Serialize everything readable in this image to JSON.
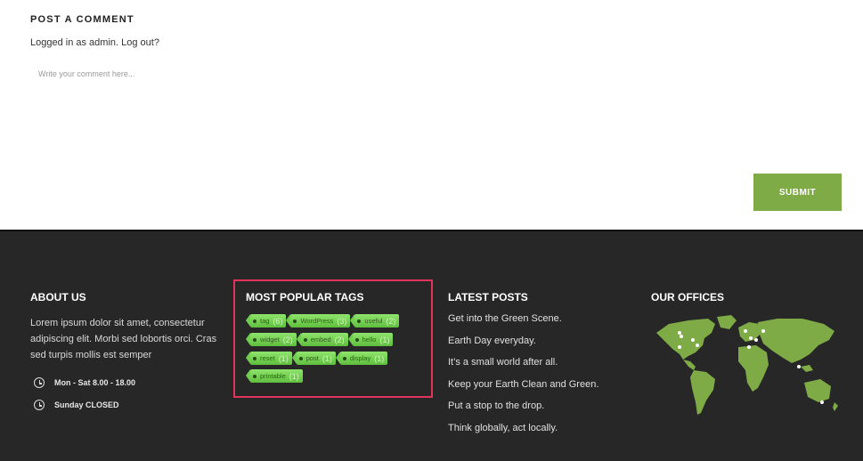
{
  "comment": {
    "title": "POST A COMMENT",
    "logged_in_prefix": "Logged in as admin. ",
    "logout_link": "Log out?",
    "placeholder": "Write your comment here...",
    "submit_label": "SUBMIT"
  },
  "footer": {
    "about": {
      "title": "ABOUT US",
      "text": "Lorem ipsum dolor sit amet, consectetur adipiscing elit. Morbi sed lobortis orci. Cras sed turpis mollis est semper",
      "hours_weekday": "Mon - Sat 8.00 - 18.00",
      "hours_sunday": "Sunday CLOSED"
    },
    "tags": {
      "title": "MOST POPULAR TAGS",
      "rows": [
        [
          {
            "name": "tag",
            "count": "(6)"
          },
          {
            "name": "WordPress",
            "count": "(3)"
          },
          {
            "name": "useful",
            "count": "(2)"
          }
        ],
        [
          {
            "name": "widget",
            "count": "(2)"
          },
          {
            "name": "embed",
            "count": "(2)"
          },
          {
            "name": "hello",
            "count": "(1)"
          }
        ],
        [
          {
            "name": "reset",
            "count": "(1)"
          },
          {
            "name": "post",
            "count": "(1)"
          },
          {
            "name": "display",
            "count": "(1)"
          }
        ],
        [
          {
            "name": "printable",
            "count": "(1)"
          }
        ]
      ]
    },
    "posts": {
      "title": "LATEST POSTS",
      "items": [
        "Get into the Green Scene.",
        "Earth Day everyday.",
        "It’s a small world after all.",
        "Keep your Earth Clean and Green.",
        "Put a stop to the drop.",
        "Think globally, act locally."
      ]
    },
    "offices": {
      "title": "OUR OFFICES",
      "map_color": "#7fab47"
    }
  },
  "colors": {
    "accent": "#7fab47",
    "footer_bg": "#272727",
    "highlight_border": "#e2335a"
  }
}
